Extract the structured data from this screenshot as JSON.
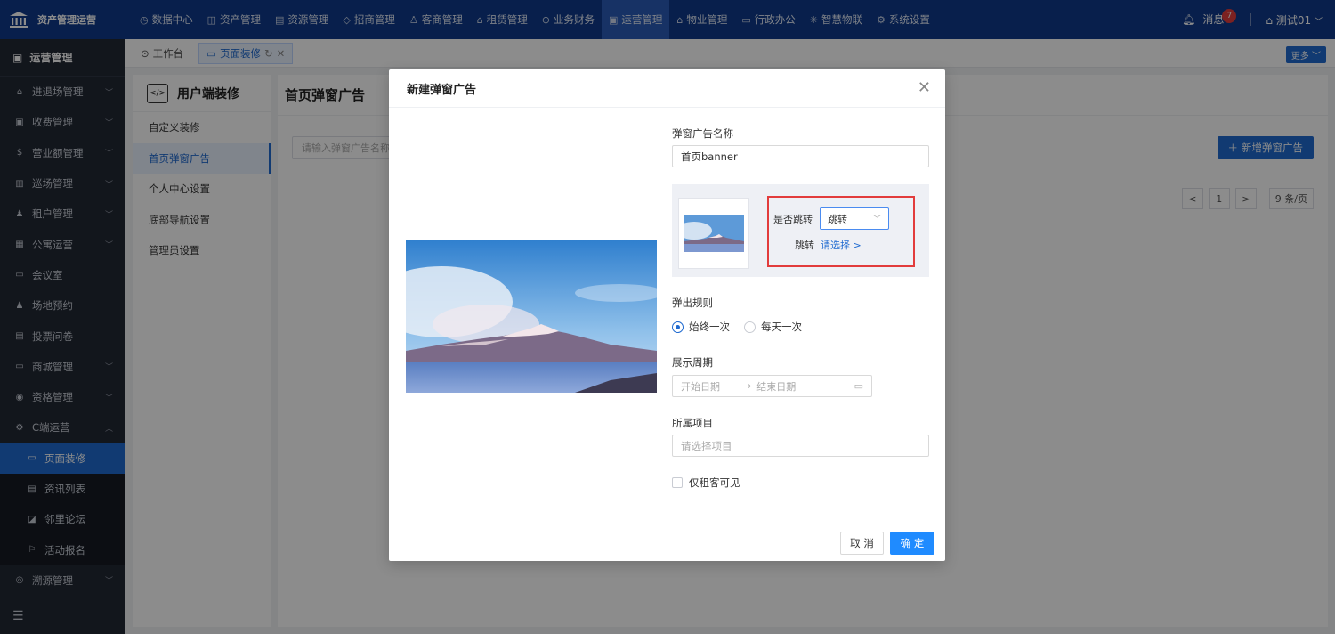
{
  "brand": {
    "name": "资产管理运营"
  },
  "topnav": [
    {
      "icon": "◷",
      "label": "数据中心"
    },
    {
      "icon": "◫",
      "label": "资产管理"
    },
    {
      "icon": "▤",
      "label": "资源管理"
    },
    {
      "icon": "◇",
      "label": "招商管理"
    },
    {
      "icon": "♙",
      "label": "客商管理"
    },
    {
      "icon": "⌂",
      "label": "租赁管理"
    },
    {
      "icon": "⊙",
      "label": "业务财务"
    },
    {
      "icon": "▣",
      "label": "运营管理"
    },
    {
      "icon": "⌂",
      "label": "物业管理"
    },
    {
      "icon": "▭",
      "label": "行政办公"
    },
    {
      "icon": "✳",
      "label": "智慧物联"
    },
    {
      "icon": "⚙",
      "label": "系统设置"
    }
  ],
  "topright": {
    "messages_label": "消息",
    "messages_count": "7",
    "user": "测试01"
  },
  "sidebar": {
    "header": "运营管理",
    "items": [
      {
        "icon": "⌂",
        "label": "进退场管理",
        "chevron": "﹀"
      },
      {
        "icon": "▣",
        "label": "收费管理",
        "chevron": "﹀"
      },
      {
        "icon": "$",
        "label": "营业额管理",
        "chevron": "﹀"
      },
      {
        "icon": "▥",
        "label": "巡场管理",
        "chevron": "﹀"
      },
      {
        "icon": "♟",
        "label": "租户管理",
        "chevron": "﹀"
      },
      {
        "icon": "▦",
        "label": "公寓运营",
        "chevron": "﹀"
      },
      {
        "icon": "▭",
        "label": "会议室",
        "chevron": ""
      },
      {
        "icon": "♟",
        "label": "场地预约",
        "chevron": ""
      },
      {
        "icon": "▤",
        "label": "投票问卷",
        "chevron": ""
      },
      {
        "icon": "▭",
        "label": "商城管理",
        "chevron": "﹀"
      },
      {
        "icon": "◉",
        "label": "资格管理",
        "chevron": "﹀"
      },
      {
        "icon": "⚙",
        "label": "C端运营",
        "chevron": "︿"
      }
    ],
    "subitems": [
      {
        "icon": "▭",
        "label": "页面装修",
        "active": true
      },
      {
        "icon": "▤",
        "label": "资讯列表",
        "active": false
      },
      {
        "icon": "◪",
        "label": "邻里论坛",
        "active": false
      },
      {
        "icon": "⚐",
        "label": "活动报名",
        "active": false
      }
    ],
    "last_item": {
      "icon": "◎",
      "label": "溯源管理",
      "chevron": "﹀"
    },
    "collapse_icon": "☰"
  },
  "tabs": [
    {
      "icon": "⊙",
      "label": "工作台"
    },
    {
      "icon": "▭",
      "label": "页面装修",
      "refresh": "↻",
      "close": "✕"
    }
  ],
  "more_label": "更多 ﹀",
  "left_panel": {
    "title": "用户端装修",
    "code_icon": "</>",
    "items": [
      "自定义装修",
      "首页弹窗广告",
      "个人中心设置",
      "底部导航设置",
      "管理员设置"
    ]
  },
  "main_panel": {
    "title": "首页弹窗广告",
    "search_placeholder": "请输入弹窗广告名称",
    "add_label": "新增弹窗广告",
    "pager": {
      "prev": "<",
      "page": "1",
      "next": ">",
      "size": "9 条/页"
    }
  },
  "modal": {
    "title": "新建弹窗广告",
    "name_label": "弹窗广告名称",
    "name_value": "首页banner",
    "jump_label": "是否跳转",
    "jump_value": "跳转",
    "jump_target_label": "跳转",
    "jump_target_link": "请选择 >",
    "rule_label": "弹出规则",
    "rule_options": [
      "始终一次",
      "每天一次"
    ],
    "period_label": "展示周期",
    "start_placeholder": "开始日期",
    "end_placeholder": "结束日期",
    "project_label": "所属项目",
    "project_placeholder": "请选择项目",
    "tenant_only_label": "仅租客可见",
    "cancel_label": "取 消",
    "ok_label": "确 定"
  }
}
